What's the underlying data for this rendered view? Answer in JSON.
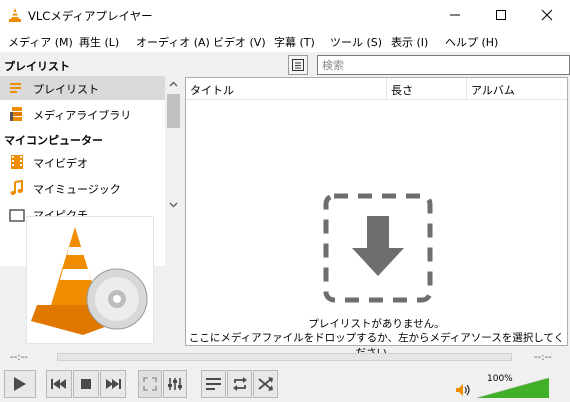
{
  "window": {
    "title": "VLCメディアプレイヤー",
    "minimize_icon": "minimize-icon",
    "maximize_icon": "maximize-icon",
    "close_icon": "close-icon"
  },
  "menu": {
    "items": [
      "メディア (M)",
      "再生 (L)",
      "オーディオ (A)",
      "ビデオ (V)",
      "字幕 (T)",
      "ツール (S)",
      "表示 (I)",
      "ヘルプ (H)"
    ]
  },
  "sidebar": {
    "header": "プレイリスト",
    "items": [
      {
        "label": "プレイリスト",
        "icon": "playlist-icon",
        "selected": true
      },
      {
        "label": "メディアライブラリ",
        "icon": "media-library-icon",
        "selected": false
      }
    ],
    "section": "マイコンピューター",
    "computer_items": [
      {
        "label": "マイビデオ",
        "icon": "video-icon"
      },
      {
        "label": "マイミュージック",
        "icon": "music-icon"
      },
      {
        "label": "マイピクチ",
        "icon": "pictures-icon"
      }
    ]
  },
  "playlist": {
    "search_placeholder": "検索",
    "columns": [
      "タイトル",
      "長さ",
      "アルバム"
    ],
    "empty_line1": "プレイリストがありません。",
    "empty_line2": "ここにメディアファイルをドロップするか、左からメディアソースを選択してください。"
  },
  "seek": {
    "elapsed": "--:--",
    "remaining": "--:--"
  },
  "volume": {
    "percent_label": "100%",
    "level": 1.0
  },
  "colors": {
    "accent_orange": "#f08c00",
    "volume_green": "#43b02a",
    "drop_gray": "#6e6e6e"
  }
}
